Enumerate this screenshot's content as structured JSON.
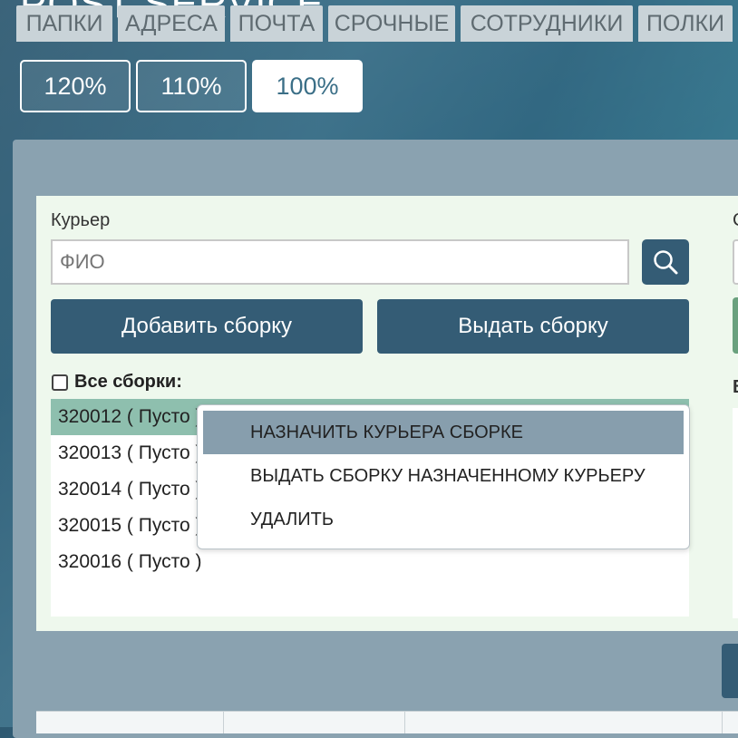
{
  "app": {
    "title": "POST SERVICE"
  },
  "zoom": {
    "options": [
      "120%",
      "110%",
      "100%"
    ],
    "selected": "100%"
  },
  "tabs": [
    "ПАПКИ",
    "АДРЕСА",
    "ПОЧТА",
    "СРОЧНЫЕ",
    "СОТРУДНИКИ",
    "ПОЛКИ"
  ],
  "courier": {
    "label": "Курьер",
    "placeholder": "ФИО",
    "value": ""
  },
  "right_column": {
    "label_top": "С",
    "label_mid": "В"
  },
  "actions": {
    "add_assembly": "Добавить сборку",
    "issue_assembly": "Выдать сборку"
  },
  "assemblies": {
    "all_label": "Все сборки:",
    "all_checked": false,
    "items": [
      "320012 ( Пусто )",
      "320013 ( Пусто )",
      "320014 ( Пусто )",
      "320015 ( Пусто )",
      "320016 ( Пусто )"
    ],
    "selected_index": 0
  },
  "context_menu": {
    "items": [
      "НАЗНАЧИТЬ КУРЬЕРА СБОРКЕ",
      "ВЫДАТЬ СБОРКУ НАЗНАЧЕННОМУ КУРЬЕРУ",
      "УДАЛИТЬ"
    ],
    "highlighted_index": 0
  },
  "colors": {
    "primary_button": "#345c75",
    "selected_row": "#8ebfae",
    "menu_highlight": "#879ead",
    "content_bg": "#eef8ed"
  }
}
